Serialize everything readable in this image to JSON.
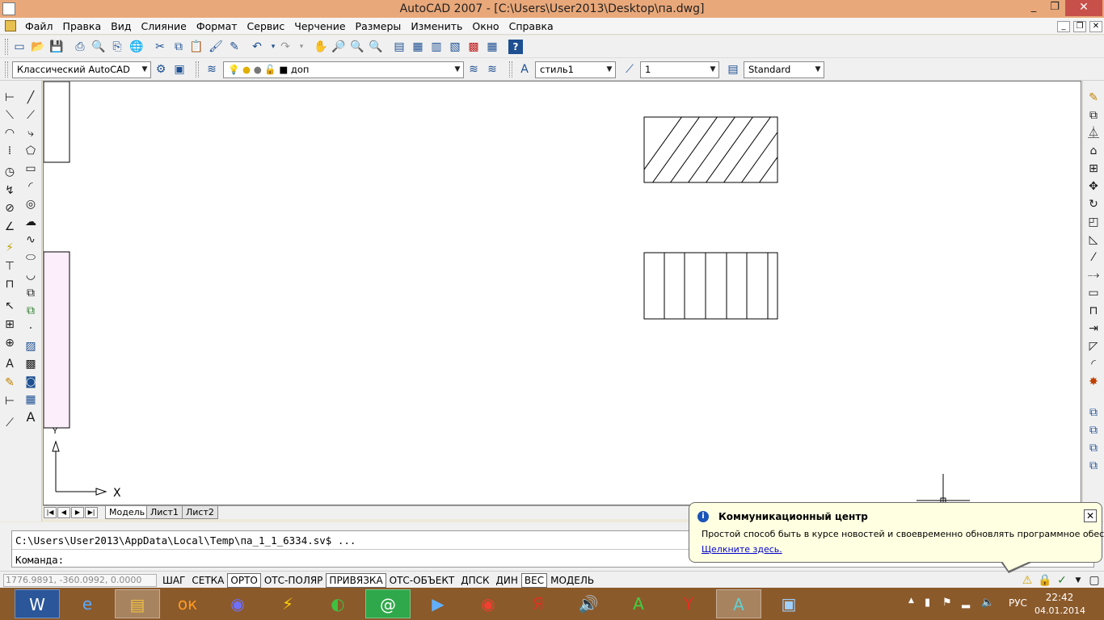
{
  "window": {
    "title": "AutoCAD 2007 - [C:\\Users\\User2013\\Desktop\\па.dwg]",
    "min": "_",
    "restore": "❐",
    "close": "✕"
  },
  "menu": [
    "Файл",
    "Правка",
    "Вид",
    "Слияние",
    "Формат",
    "Сервис",
    "Черчение",
    "Размеры",
    "Изменить",
    "Окно",
    "Справка"
  ],
  "toolbar2": {
    "workspace": "Классический AutoCAD",
    "layer": "доп",
    "text_style": "стиль1",
    "dim_scale": "1",
    "table_style": "Standard"
  },
  "layout_tabs": [
    "Модель",
    "Лист1",
    "Лист2"
  ],
  "ucs": {
    "x_label": "X",
    "y_label": "Y"
  },
  "command": {
    "history": "C:\\Users\\User2013\\AppData\\Local\\Temp\\па_1_1_6334.sv$ ...",
    "prompt": "Команда:"
  },
  "status": {
    "coords": "1776.9891, -360.0992, 0.0000",
    "toggles": [
      {
        "label": "ШАГ",
        "on": false
      },
      {
        "label": "СЕТКА",
        "on": false
      },
      {
        "label": "ОРТО",
        "on": true
      },
      {
        "label": "ОТС-ПОЛЯР",
        "on": false
      },
      {
        "label": "ПРИВЯЗКА",
        "on": true
      },
      {
        "label": "ОТС-ОБЪЕКТ",
        "on": false
      },
      {
        "label": "ДПСК",
        "on": false
      },
      {
        "label": "ДИН",
        "on": false
      },
      {
        "label": "ВЕС",
        "on": true
      },
      {
        "label": "МОДЕЛЬ",
        "on": false
      }
    ]
  },
  "balloon": {
    "title": "Коммуникационный центр",
    "text": "Простой способ быть в курсе новостей и своевременно обновлять программное обеспечение.",
    "link": "Щелкните здесь.",
    "close": "✕",
    "info": "i"
  },
  "tray": {
    "lang": "РУС",
    "time": "22:42",
    "date": "04.01.2014"
  },
  "colors": {
    "titlebar": "#e9a87a",
    "taskbar": "#8b5a2b",
    "balloon": "#ffffe1",
    "close_button": "#c7504b",
    "pink_panel": "#fdeefc"
  }
}
